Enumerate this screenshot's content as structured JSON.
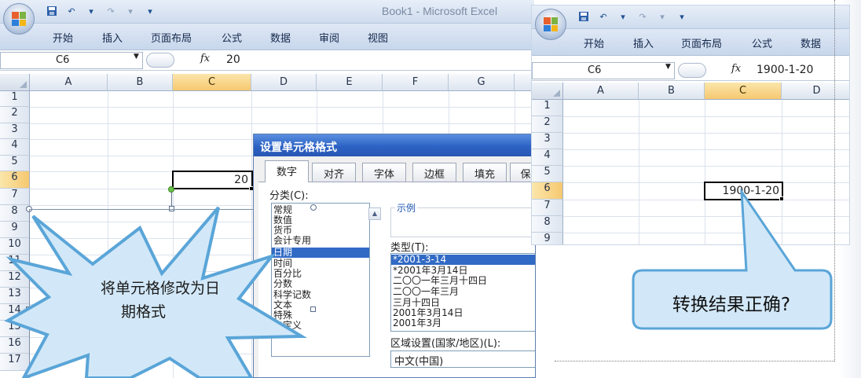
{
  "window1": {
    "title": "Book1 - Microsoft Excel",
    "ribbon_tabs": [
      "开始",
      "插入",
      "页面布局",
      "公式",
      "数据",
      "审阅",
      "视图"
    ],
    "name_box": "C6",
    "fx_label": "fx",
    "formula_value": "20",
    "columns": [
      "A",
      "B",
      "C",
      "D",
      "E",
      "F",
      "G"
    ],
    "rows": [
      "1",
      "2",
      "3",
      "4",
      "5",
      "6",
      "7",
      "8",
      "9",
      "10",
      "11",
      "12",
      "13",
      "14",
      "15",
      "16",
      "17"
    ],
    "active_cell_value": "20",
    "selected_column": "C",
    "selected_row": "6"
  },
  "dialog": {
    "title": "设置单元格格式",
    "tabs": [
      "数字",
      "对齐",
      "字体",
      "边框",
      "填充",
      "保"
    ],
    "active_tab": "数字",
    "category_label": "分类(C):",
    "categories": [
      "常规",
      "数值",
      "货币",
      "会计专用",
      "日期",
      "时间",
      "百分比",
      "分数",
      "科学记数",
      "文本",
      "特殊",
      "自定义"
    ],
    "selected_category": "日期",
    "sample_label": "示例",
    "type_label": "类型(T):",
    "types": [
      "*2001-3-14",
      "*2001年3月14日",
      "二〇〇一年三月十四日",
      "二〇〇一年三月",
      "三月十四日",
      "2001年3月14日",
      "2001年3月"
    ],
    "selected_type": "*2001-3-14",
    "locale_label": "区域设置(国家/地区)(L):",
    "locale_value": "中文(中国)"
  },
  "window2": {
    "ribbon_tabs": [
      "开始",
      "插入",
      "页面布局",
      "公式",
      "数据"
    ],
    "name_box": "C6",
    "fx_label": "fx",
    "formula_value": "1900-1-20",
    "columns": [
      "A",
      "B",
      "C",
      "D"
    ],
    "rows": [
      "1",
      "2",
      "3",
      "4",
      "5",
      "6",
      "7",
      "8",
      "9"
    ],
    "active_cell_value": "1900-1-20",
    "selected_column": "C",
    "selected_row": "6"
  },
  "callouts": {
    "burst_line1": "将单元格修改为日",
    "burst_line2": "期格式",
    "speech": "转换结果正确?"
  },
  "colors": {
    "ribbon_blue": "#cfdcee",
    "selection_orange": "#f6c870",
    "dialog_title_blue": "#2c62c4",
    "list_selection": "#316ac5",
    "callout_fill": "#d2e8f8",
    "callout_stroke": "#5aa5d8"
  },
  "icons": [
    "office-orb-icon",
    "save-icon",
    "undo-icon",
    "redo-icon",
    "qat-dropdown-icon",
    "fx-icon",
    "scroll-up-icon"
  ]
}
